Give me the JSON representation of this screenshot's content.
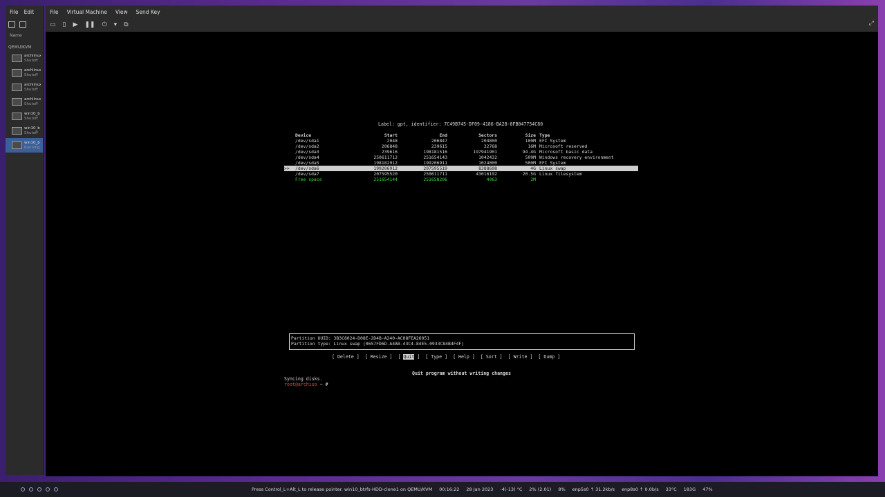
{
  "manager": {
    "menu": [
      "File",
      "Edit"
    ],
    "column_name": "Name",
    "connection": "QEMU/KVM",
    "vms": [
      {
        "name": "archlinux",
        "status": "Shutoff",
        "selected": false
      },
      {
        "name": "archlinux",
        "status": "Shutoff",
        "selected": false
      },
      {
        "name": "archlinux",
        "status": "Shutoff",
        "selected": false
      },
      {
        "name": "archlinux",
        "status": "Shutoff",
        "selected": false
      },
      {
        "name": "win10_b",
        "status": "Shutoff",
        "selected": false
      },
      {
        "name": "win10_b",
        "status": "Shutoff",
        "selected": false
      },
      {
        "name": "win10_b",
        "status": "Running",
        "selected": true
      }
    ]
  },
  "vmwindow": {
    "menu": [
      "File",
      "Virtual Machine",
      "View",
      "Send Key"
    ]
  },
  "cfdisk": {
    "label_line": "Label: gpt, identifier: 7C49B745-DF09-4186-BA28-8FB047754C80",
    "headers": {
      "device": "Device",
      "start": "Start",
      "end": "End",
      "sectors": "Sectors",
      "size": "Size",
      "type": "Type"
    },
    "rows": [
      {
        "mark": "",
        "device": "/dev/sda1",
        "start": "2048",
        "end": "206847",
        "sectors": "204800",
        "size": "100M",
        "type": "EFI System",
        "state": "normal"
      },
      {
        "mark": "",
        "device": "/dev/sda2",
        "start": "206848",
        "end": "239615",
        "sectors": "32768",
        "size": "16M",
        "type": "Microsoft reserved",
        "state": "normal"
      },
      {
        "mark": "",
        "device": "/dev/sda3",
        "start": "239616",
        "end": "198181516",
        "sectors": "197941901",
        "size": "94.4G",
        "type": "Microsoft basic data",
        "state": "normal"
      },
      {
        "mark": "",
        "device": "/dev/sda4",
        "start": "250611712",
        "end": "251654143",
        "sectors": "1042432",
        "size": "509M",
        "type": "Windows recovery environment",
        "state": "normal"
      },
      {
        "mark": "",
        "device": "/dev/sda5",
        "start": "198182912",
        "end": "199206911",
        "sectors": "1024000",
        "size": "500M",
        "type": "EFI System",
        "state": "normal"
      },
      {
        "mark": ">>",
        "device": "/dev/sda6",
        "start": "199206912",
        "end": "207595519",
        "sectors": "8388608",
        "size": "4G",
        "type": "Linux swap",
        "state": "selected"
      },
      {
        "mark": "",
        "device": "/dev/sda7",
        "start": "207595520",
        "end": "250611711",
        "sectors": "43016192",
        "size": "20.5G",
        "type": "Linux filesystem",
        "state": "normal"
      },
      {
        "mark": "",
        "device": "Free space",
        "start": "251654144",
        "end": "251658206",
        "sectors": "4063",
        "size": "2M",
        "type": "",
        "state": "free"
      }
    ],
    "info": {
      "uuid": "Partition UUID: 3B3C6024-D08E-2D4B-A240-AC08FEA26051",
      "ptype": "Partition type: Linux swap (0657FD6D-A4AB-43C4-84E5-0933C84B4F4F)"
    },
    "buttons": [
      "Delete",
      "Resize",
      "Quit",
      "Type",
      "Help",
      "Sort",
      "Write",
      "Dump"
    ],
    "active_button": "Quit",
    "hint": "Quit program without writing changes",
    "syncing": "Syncing disks.",
    "prompt_user": "root@archiso",
    "prompt_rest": " ~ #"
  },
  "taskbar": {
    "hint": "Press Control_L+Alt_L to release pointer. win10_btrfs-HDD-clone1 on QEMU/KVM",
    "time": "00:16:22",
    "date": "28 Jan 2023",
    "temp": "-4(-13) °C",
    "cpu": "2% (2.01)",
    "mem": "8%",
    "net1": "enp5s0 ↑ 31.2kb/s",
    "net2": "enp8s0 ↑ 0.0b/s",
    "cputemp": "33°C",
    "disk": "183G",
    "battery": "47%"
  }
}
